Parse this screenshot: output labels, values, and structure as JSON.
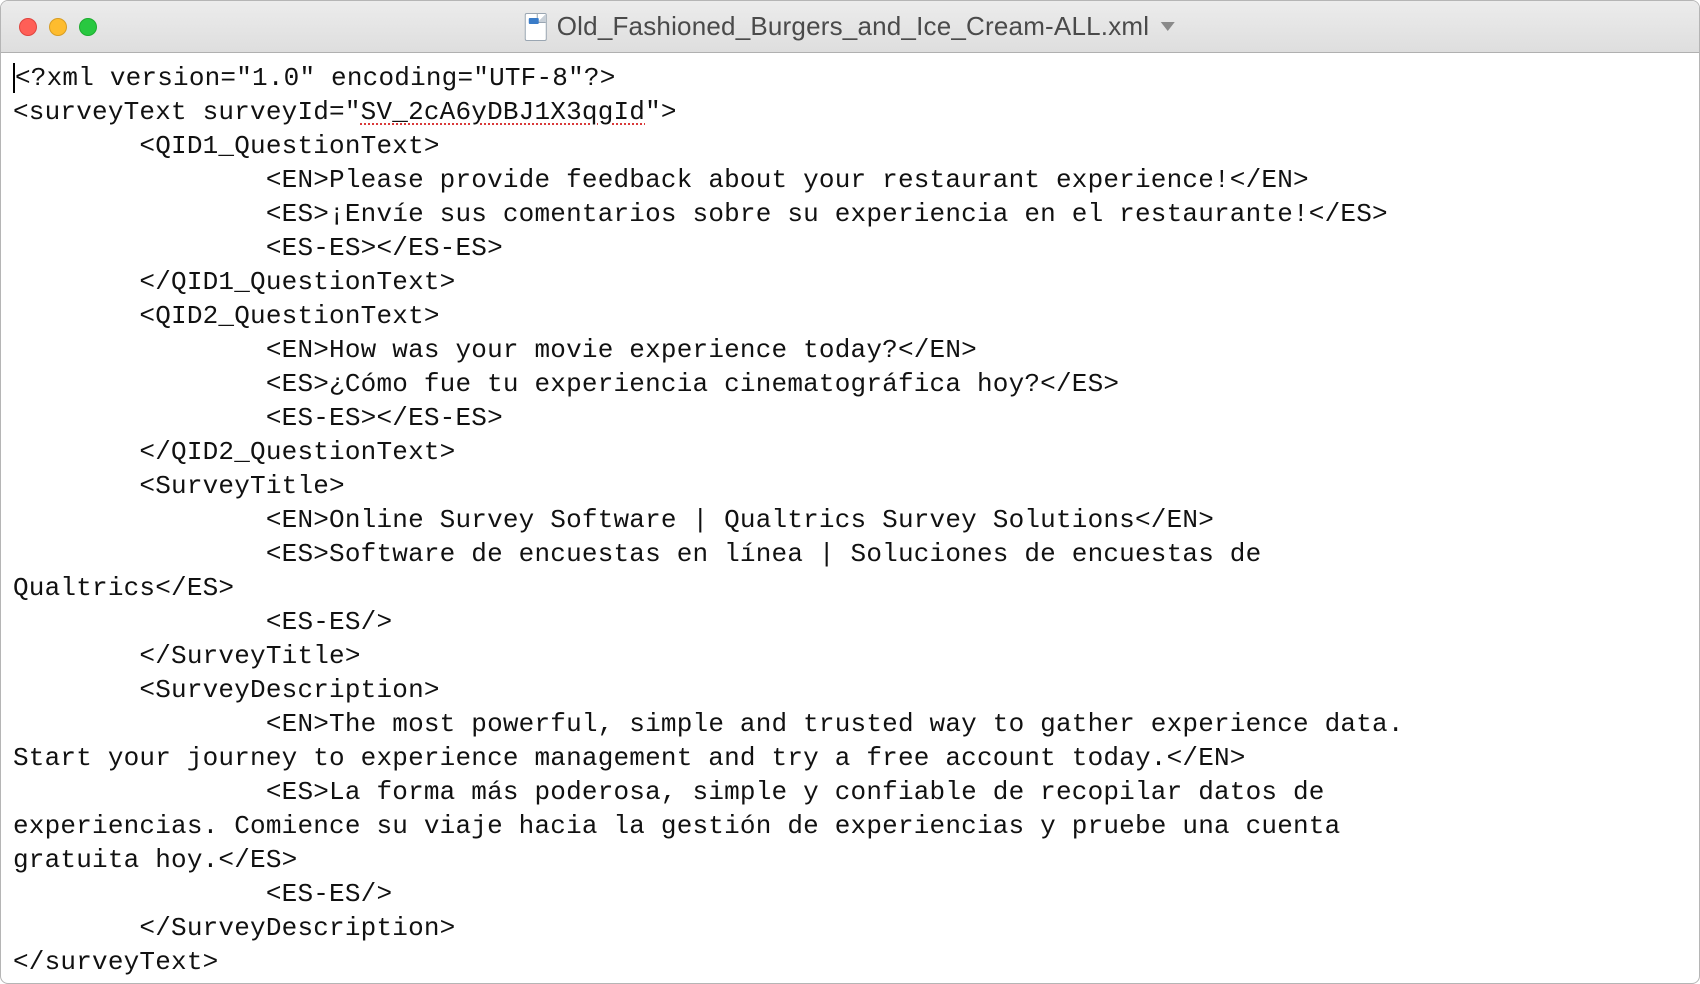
{
  "window": {
    "filename": "Old_Fashioned_Burgers_and_Ice_Cream-ALL.xml"
  },
  "xml": {
    "declaration": "<?xml version=\"1.0\" encoding=\"UTF-8\"?>",
    "root_open_prefix": "<surveyText surveyId=\"",
    "surveyId": "SV_2cA6yDBJ1X3qgId",
    "root_open_suffix": "\">",
    "qid1_open": "<QID1_QuestionText>",
    "qid1_en": "<EN>Please provide feedback about your restaurant experience!</EN>",
    "qid1_es": "<ES>¡Envíe sus comentarios sobre su experiencia en el restaurante!</ES>",
    "qid1_eses": "<ES-ES></ES-ES>",
    "qid1_close": "</QID1_QuestionText>",
    "qid2_open": "<QID2_QuestionText>",
    "qid2_en": "<EN>How was your movie experience today?</EN>",
    "qid2_es": "<ES>¿Cómo fue tu experiencia cinematográfica hoy?</ES>",
    "qid2_eses": "<ES-ES></ES-ES>",
    "qid2_close": "</QID2_QuestionText>",
    "stitle_open": "<SurveyTitle>",
    "stitle_en": "<EN>Online Survey Software | Qualtrics Survey Solutions</EN>",
    "stitle_es_a": "<ES>Software de encuestas en línea | Soluciones de encuestas de ",
    "stitle_es_b": "Qualtrics</ES>",
    "stitle_eses": "<ES-ES/>",
    "stitle_close": "</SurveyTitle>",
    "sdesc_open": "<SurveyDescription>",
    "sdesc_en_a": "<EN>The most powerful, simple and trusted way to gather experience data. ",
    "sdesc_en_b": "Start your journey to experience management and try a free account today.</EN>",
    "sdesc_es_a": "<ES>La forma más poderosa, simple y confiable de recopilar datos de ",
    "sdesc_es_b": "experiencias. Comience su viaje hacia la gestión de experiencias y pruebe una cuenta ",
    "sdesc_es_c": "gratuita hoy.</ES>",
    "sdesc_eses": "<ES-ES/>",
    "sdesc_close": "</SurveyDescription>",
    "root_close": "</surveyText>"
  },
  "indent": {
    "l0": "",
    "l1": "        ",
    "l2": "                "
  }
}
